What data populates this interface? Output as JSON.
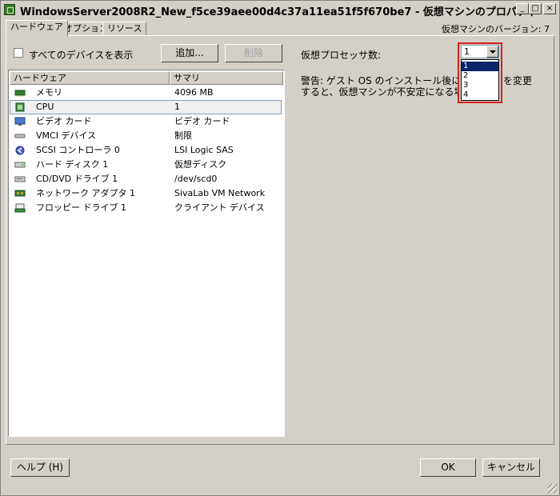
{
  "window": {
    "title": "WindowsServer2008R2_New_f5ce39aee00d4c37a11ea51f5f670be7 - 仮想マシンのプロパティ"
  },
  "titlebar": {
    "minimize": "_",
    "maximize": "□",
    "close": "×"
  },
  "tabs": [
    {
      "label": "ハードウェア"
    },
    {
      "label": "オプション"
    },
    {
      "label": "リソース"
    }
  ],
  "version_label": "仮想マシンのバージョン: 7",
  "show_all_devices": {
    "label": "すべてのデバイスを表示",
    "checked": false
  },
  "buttons": {
    "add": "追加...",
    "remove": "削除",
    "help": "ヘルプ (H)",
    "ok": "OK",
    "cancel": "キャンセル"
  },
  "hardware_table": {
    "headers": [
      "ハードウェア",
      "サマリ"
    ],
    "rows": [
      {
        "icon": "memory-icon",
        "name": "メモリ",
        "summary": "4096 MB"
      },
      {
        "icon": "cpu-icon",
        "name": "CPU",
        "summary": "1",
        "selected": true
      },
      {
        "icon": "video-card-icon",
        "name": "ビデオ カード",
        "summary": "ビデオ カード"
      },
      {
        "icon": "vmci-icon",
        "name": "VMCI デバイス",
        "summary": "制限"
      },
      {
        "icon": "scsi-icon",
        "name": "SCSI コントローラ 0",
        "summary": "LSI Logic SAS"
      },
      {
        "icon": "hard-disk-icon",
        "name": "ハード ディスク 1",
        "summary": "仮想ディスク"
      },
      {
        "icon": "cd-dvd-icon",
        "name": "CD/DVD ドライブ 1",
        "summary": "/dev/scd0"
      },
      {
        "icon": "network-adapter-icon",
        "name": "ネットワーク アダプタ 1",
        "summary": "SivaLab VM Network"
      },
      {
        "icon": "floppy-icon",
        "name": "フロッピー ドライブ 1",
        "summary": "クライアント デバイス"
      }
    ]
  },
  "processor": {
    "label": "仮想プロセッサ数:",
    "value": "1",
    "options": [
      "1",
      "2",
      "3",
      "4"
    ]
  },
  "warning": {
    "line1": "警告: ゲスト OS のインストール後に仮想プ",
    "line1_end": "を変更",
    "line2": "すると、仮想マシンが不安定になる場合が"
  },
  "colors": {
    "highlight": "#d82020",
    "selection": "#0a246a"
  }
}
